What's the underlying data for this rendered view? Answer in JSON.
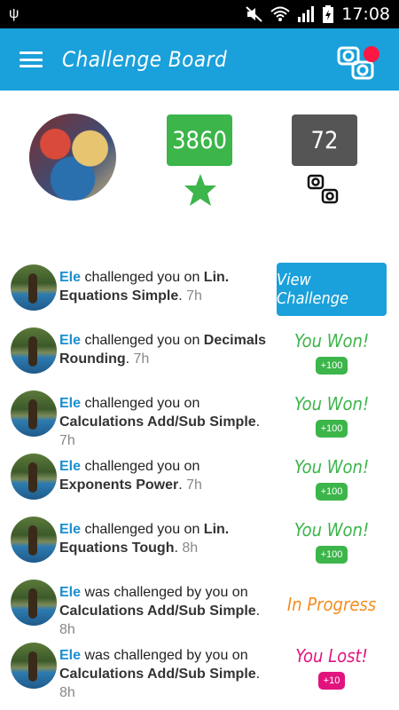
{
  "status_bar": {
    "time": "17:08",
    "icons": [
      "usb-icon",
      "mute-icon",
      "wifi-icon",
      "signal-icon",
      "battery-icon"
    ]
  },
  "app_bar": {
    "title": "Challenge Board",
    "menu_icon": "hamburger-icon",
    "notification_icon": "challenge-clash-icon"
  },
  "profile": {
    "score": "3860",
    "score_icon": "star-icon",
    "challenges_count": "72",
    "challenges_icon": "challenge-clash-icon"
  },
  "challenges": [
    {
      "name": "Ele",
      "prefix": " challenged you on ",
      "topic": "Lin. Equations Simple",
      "time": "7h",
      "status": "button",
      "status_label": "View Challenge",
      "reward": ""
    },
    {
      "name": "Ele",
      "prefix": " challenged you on ",
      "topic": "Decimals Rounding",
      "time": "7h",
      "status": "won",
      "status_label": "You Won!",
      "reward": "+100"
    },
    {
      "name": "Ele",
      "prefix": " challenged you on ",
      "topic": "Calculations Add/Sub Simple",
      "time": "7h",
      "status": "won",
      "status_label": "You Won!",
      "reward": "+100"
    },
    {
      "name": "Ele",
      "prefix": " challenged you on ",
      "topic": "Exponents Power",
      "time": "7h",
      "status": "won",
      "status_label": "You Won!",
      "reward": "+100"
    },
    {
      "name": "Ele",
      "prefix": " challenged you on ",
      "topic": "Lin. Equations Tough",
      "time": "8h",
      "status": "won",
      "status_label": "You Won!",
      "reward": "+100"
    },
    {
      "name": "Ele",
      "prefix": " was challenged by you on ",
      "topic": "Calculations Add/Sub Simple",
      "time": "8h",
      "status": "progress",
      "status_label": "In Progress",
      "reward": ""
    },
    {
      "name": "Ele",
      "prefix": " was challenged by you on ",
      "topic": "Calculations Add/Sub Simple",
      "time": "8h",
      "status": "lost",
      "status_label": "You Lost!",
      "reward": "+10"
    }
  ],
  "colors": {
    "primary": "#1aa0da",
    "won": "#3cb54a",
    "progress": "#f58d1f",
    "lost": "#e1147e",
    "badge": "#ff1744"
  }
}
